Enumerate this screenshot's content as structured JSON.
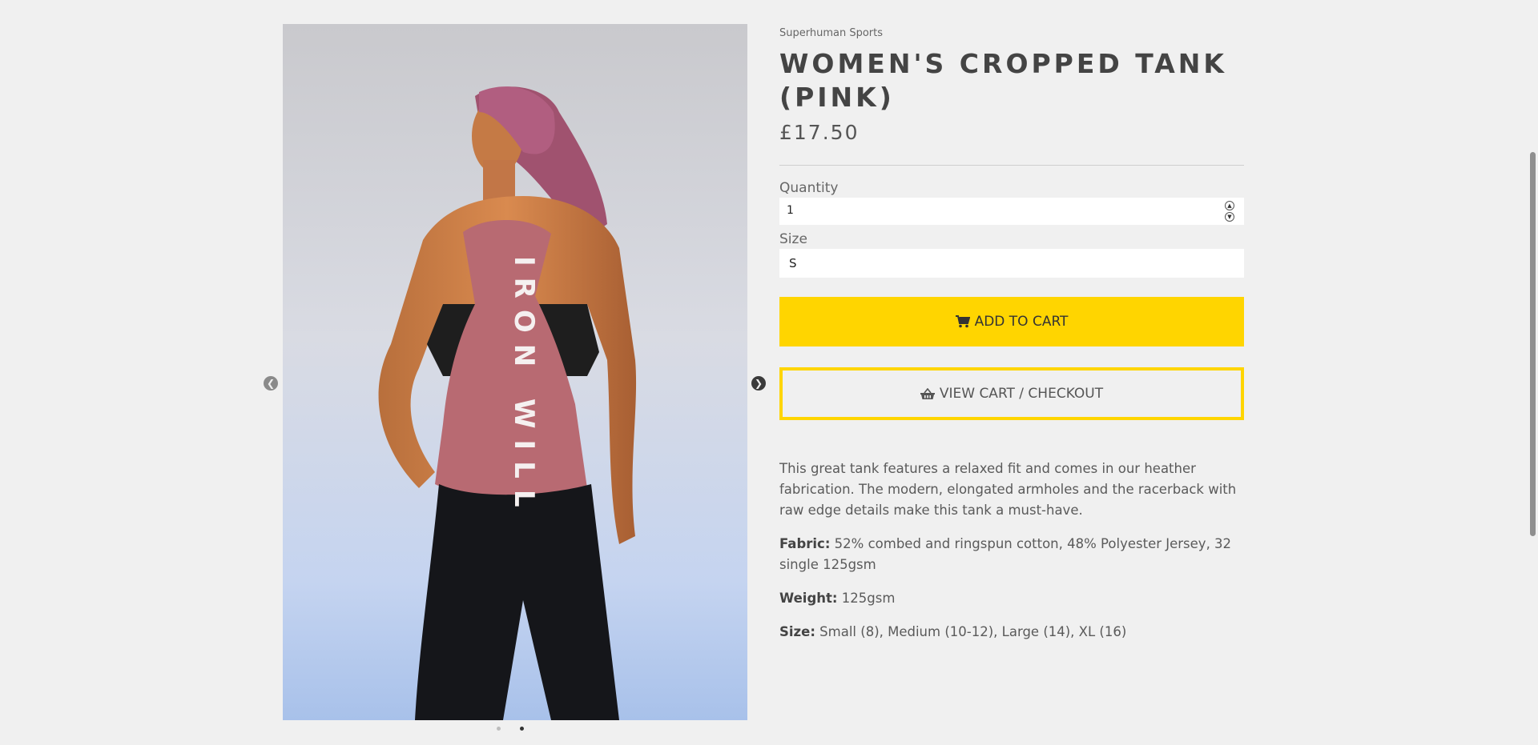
{
  "product": {
    "vendor": "Superhuman Sports",
    "title": "WOMEN'S CROPPED TANK (PINK)",
    "price": "£17.50",
    "image_alt_text": "IRON WILL"
  },
  "form": {
    "quantity_label": "Quantity",
    "quantity_value": "1",
    "size_label": "Size",
    "size_value": "S"
  },
  "buttons": {
    "add_to_cart": "ADD TO CART",
    "view_cart": "VIEW CART / CHECKOUT"
  },
  "description": {
    "intro": "This great tank features a relaxed fit and comes in our heather fabrication. The modern, elongated armholes and the racerback with raw edge details make this tank a must-have.",
    "fabric_label": "Fabric:",
    "fabric_value": " 52% combed and ringspun cotton, 48% Polyester Jersey, 32 single 125gsm",
    "weight_label": "Weight:",
    "weight_value": " 125gsm",
    "size_label": "Size:",
    "size_value": " Small (8), Medium (10-12), Large (14), XL (16)"
  },
  "gallery": {
    "prev_icon": "chevron-left-icon",
    "next_icon": "chevron-right-icon",
    "slide_count": 2,
    "active_slide": 2
  },
  "colors": {
    "accent": "#ffd500",
    "background": "#f0f0f0",
    "tank": "#b86a72"
  }
}
